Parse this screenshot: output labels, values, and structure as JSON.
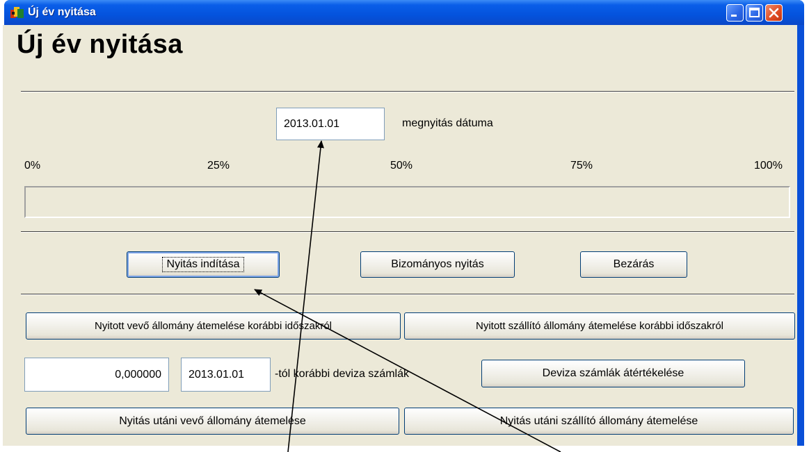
{
  "window": {
    "title": "Új év nyitása",
    "heading": "Új év nyitása"
  },
  "date_field": {
    "value": "2013.01.01",
    "label": "megnyitás dátuma"
  },
  "progress": {
    "ticks": [
      "0%",
      "25%",
      "50%",
      "75%",
      "100%"
    ],
    "value": 0
  },
  "actions": {
    "start": "Nyitás indítása",
    "consignment": "Bizományos nyitás",
    "close": "Bezárás"
  },
  "transfer": {
    "customer_prior": "Nyitott vevő állomány átemelése korábbi időszakról",
    "supplier_prior": "Nyitott szállító állomány átemelése korábbi időszakról"
  },
  "currency": {
    "rate_value": "0,000000",
    "date_value": "2013.01.01",
    "label": "-tól korábbi deviza számlák",
    "revalue_button": "Deviza számlák átértékelése"
  },
  "after_opening": {
    "customer": "Nyitás utáni vevő állomány átemelése",
    "supplier": "Nyitás utáni szállító állomány átemelése"
  }
}
